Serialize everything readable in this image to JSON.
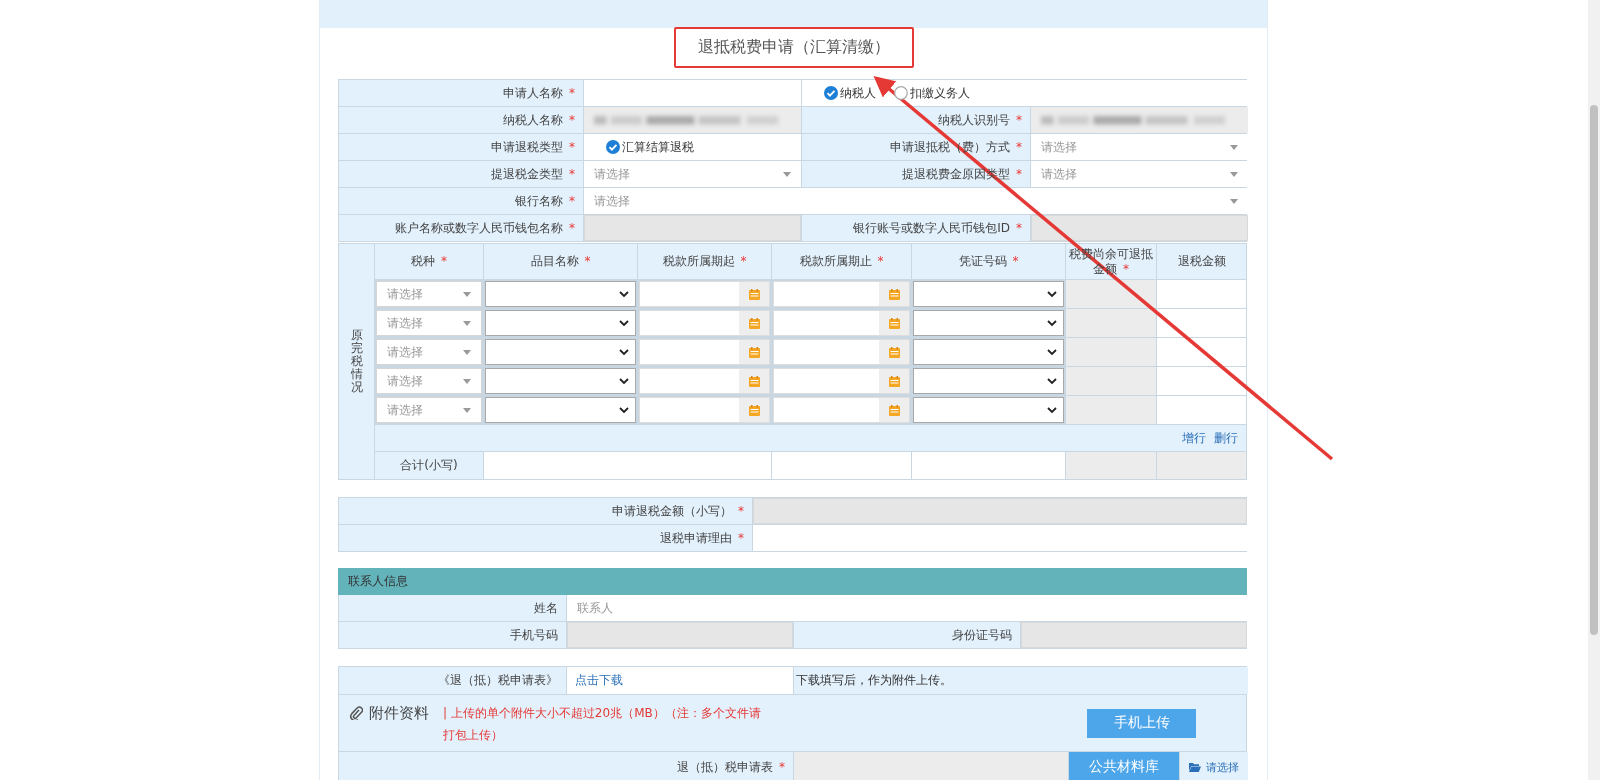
{
  "title": "退抵税费申请（汇算清缴）",
  "basic_info": {
    "rows": [
      {
        "cells": [
          {
            "kind": "label",
            "text": "申请人名称",
            "mark": "*"
          },
          {
            "kind": "input",
            "disabled": false
          },
          {
            "kind": "radios",
            "options": [
              {
                "label": "纳税人",
                "selected": true
              },
              {
                "label": "扣缴义务人",
                "selected": false
              }
            ]
          }
        ]
      },
      {
        "cells": [
          {
            "kind": "label",
            "text": "纳税人名称",
            "mark": "*"
          },
          {
            "kind": "masked",
            "disabled": true
          },
          {
            "kind": "label",
            "text": "纳税人识别号",
            "mark": "*"
          },
          {
            "kind": "masked",
            "disabled": true
          }
        ]
      },
      {
        "cells": [
          {
            "kind": "label",
            "text": "申请退税类型",
            "mark": "*"
          },
          {
            "kind": "checkbox",
            "label": "汇算结算退税",
            "checked": true
          },
          {
            "kind": "label",
            "text": "申请退抵税（费）方式",
            "mark": "*"
          },
          {
            "kind": "select",
            "placeholder": "请选择"
          }
        ]
      },
      {
        "cells": [
          {
            "kind": "label",
            "text": "提退税金类型",
            "mark": "*"
          },
          {
            "kind": "select",
            "placeholder": "请选择"
          },
          {
            "kind": "label",
            "text": "提退税费金原因类型",
            "mark": "*"
          },
          {
            "kind": "select",
            "placeholder": "请选择"
          }
        ]
      },
      {
        "cells": [
          {
            "kind": "label",
            "text": "银行名称",
            "mark": "*"
          },
          {
            "kind": "select",
            "placeholder": "请选择"
          }
        ]
      },
      {
        "cells": [
          {
            "kind": "label",
            "text": "账户名称或数字人民币钱包名称",
            "mark": "*"
          },
          {
            "kind": "input",
            "disabled": true
          },
          {
            "kind": "label",
            "text": "银行账号或数字人民币钱包ID",
            "mark": "*"
          },
          {
            "kind": "input",
            "disabled": true
          }
        ]
      }
    ]
  },
  "tax_table": {
    "side_label": "原完税情况",
    "columns": [
      {
        "text": "税种",
        "mark": "*"
      },
      {
        "text": "品目名称",
        "mark": "*"
      },
      {
        "text": "税款所属期起",
        "mark": "*"
      },
      {
        "text": "税款所属期止",
        "mark": "*"
      },
      {
        "text": "凭证号码",
        "mark": "*"
      },
      {
        "text": "税费尚余可退抵金额",
        "mark": "*"
      },
      {
        "text": "退税金额"
      }
    ],
    "rows": [
      {
        "tax_type": "请选择"
      },
      {
        "tax_type": "请选择"
      },
      {
        "tax_type": "请选择"
      },
      {
        "tax_type": "请选择"
      },
      {
        "tax_type": "请选择"
      }
    ],
    "actions": [
      "增行",
      "删行"
    ],
    "total_label": "合计(小写)"
  },
  "refund": {
    "rows": [
      {
        "label": "申请退税金额（小写）",
        "mark": "*",
        "disabled": true
      },
      {
        "label": "退税申请理由",
        "mark": "*",
        "disabled": false
      }
    ]
  },
  "contact": {
    "header": "联系人信息",
    "rows": [
      {
        "cells": [
          {
            "kind": "label",
            "text": "姓名"
          },
          {
            "kind": "input",
            "placeholder": "联系人",
            "disabled": false
          }
        ]
      },
      {
        "cells": [
          {
            "kind": "label",
            "text": "手机号码"
          },
          {
            "kind": "input",
            "disabled": true
          },
          {
            "kind": "label",
            "text": "身份证号码"
          },
          {
            "kind": "input",
            "disabled": true
          }
        ]
      }
    ]
  },
  "attachments": {
    "form_label": "《退（抵）税申请表》",
    "download_link": "点击下载",
    "download_note": "下载填写后，作为附件上传。",
    "title": "附件资料",
    "notice": "| 上传的单个附件大小不超过20兆（MB）（注：多个文件请打包上传）",
    "upload_button": "手机上传",
    "file_row": {
      "label": "退（抵）税申请表",
      "mark": "*",
      "library_button": "公共材料库",
      "choose_button": "请选择"
    }
  }
}
